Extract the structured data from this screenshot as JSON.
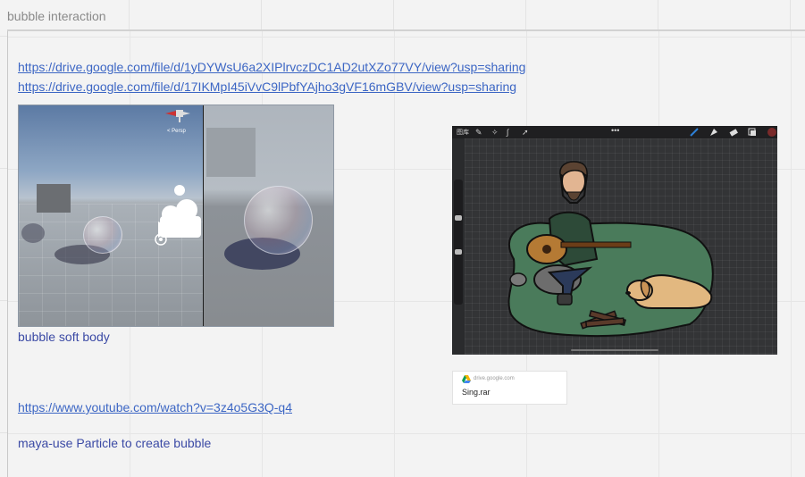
{
  "frame": {
    "title": "bubble interaction"
  },
  "links": [
    "https://drive.google.com/file/d/1yDYWsU6a2XIPlrvczDC1AD2utXZo77VY/view?usp=sharing",
    "https://drive.google.com/file/d/17IKMpI45iVvC9lPbfYAjho3gVF16mGBV/view?usp=sharing"
  ],
  "caption": "bubble soft body",
  "youtube_link": "https://www.youtube.com/watch?v=3z4o5G3Q-q4",
  "maya_note": "maya-use Particle to create bubble",
  "unity_image": {
    "gizmo_label": "< Persp"
  },
  "drive_card": {
    "domain": "drive.google.com",
    "filename": "Sing.rar"
  },
  "procreate_toolbar": {
    "gallery_label": "图库"
  },
  "colors": {
    "link": "#3c66c4",
    "note": "#3b4aa5",
    "island": "#4a7b5b"
  }
}
